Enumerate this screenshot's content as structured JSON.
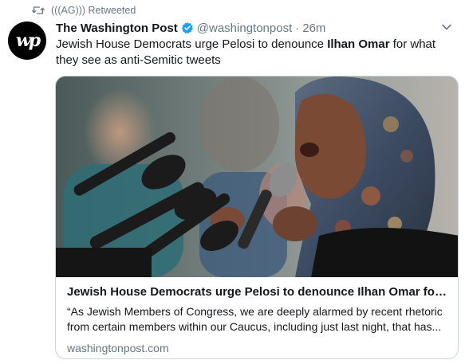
{
  "retweet": {
    "icon": "retweet-icon",
    "label": "(((AG))) Retweeted"
  },
  "tweet": {
    "avatar_text": "wp",
    "author_name": "The Washington Post",
    "verified_icon": "verified-badge-icon",
    "handle": "@washingtonpost",
    "separator": "·",
    "time": "26m",
    "menu_icon": "chevron-down-icon",
    "text_before": "Jewish House Democrats urge Pelosi to denounce ",
    "text_bold": "Ilhan Omar",
    "text_after": " for what they see as anti-Semitic tweets"
  },
  "card": {
    "image_desc": "photo-of-speaker-at-microphones",
    "title": "Jewish House Democrats urge Pelosi to denounce Ilhan Omar for ‘ha...",
    "description": "“As Jewish Members of Congress, we are deeply alarmed by recent rhetoric from certain members within our Caucus, including just last night, that has...",
    "domain": "washingtonpost.com"
  },
  "colors": {
    "text": "#14171a",
    "secondary": "#657786",
    "verified": "#1da1f2",
    "border": "#ccd6dd"
  }
}
